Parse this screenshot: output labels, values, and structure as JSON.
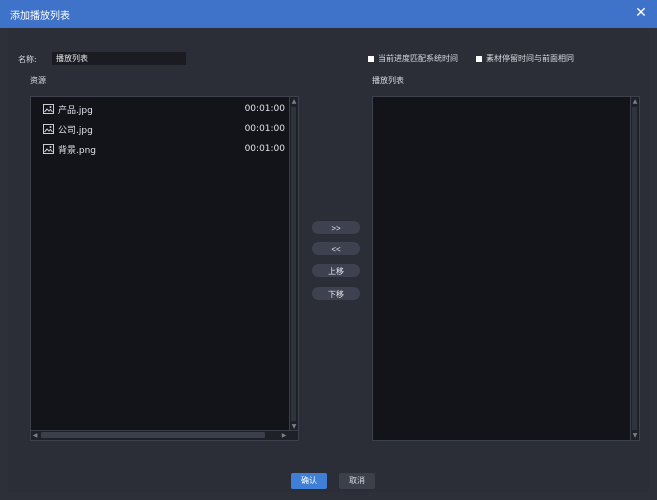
{
  "window": {
    "title": "添加播放列表",
    "close_glyph": "✕"
  },
  "form": {
    "name_label": "名称:",
    "name_value": "播放列表",
    "options": [
      {
        "label": "当前进度匹配系统时间",
        "checked": false
      },
      {
        "label": "素材停留时间与前面相同",
        "checked": false
      }
    ]
  },
  "source": {
    "label": "资源",
    "items": [
      {
        "name": "产品.jpg",
        "duration": "00:01:00",
        "icon": "image-file-icon"
      },
      {
        "name": "公司.jpg",
        "duration": "00:01:00",
        "icon": "image-file-icon"
      },
      {
        "name": "背景.png",
        "duration": "00:01:00",
        "icon": "image-file-icon"
      }
    ]
  },
  "playlist": {
    "label": "播放列表",
    "items": []
  },
  "middle_buttons": {
    "add": ">>",
    "remove": "<<",
    "up": "上移",
    "down": "下移"
  },
  "footer": {
    "confirm": "确认",
    "cancel": "取消"
  },
  "colors": {
    "titlebar": "#3f73c9",
    "dialog_bg": "#2b2e36",
    "pane_bg": "#12141a",
    "primary_button": "#3f7fd6"
  }
}
